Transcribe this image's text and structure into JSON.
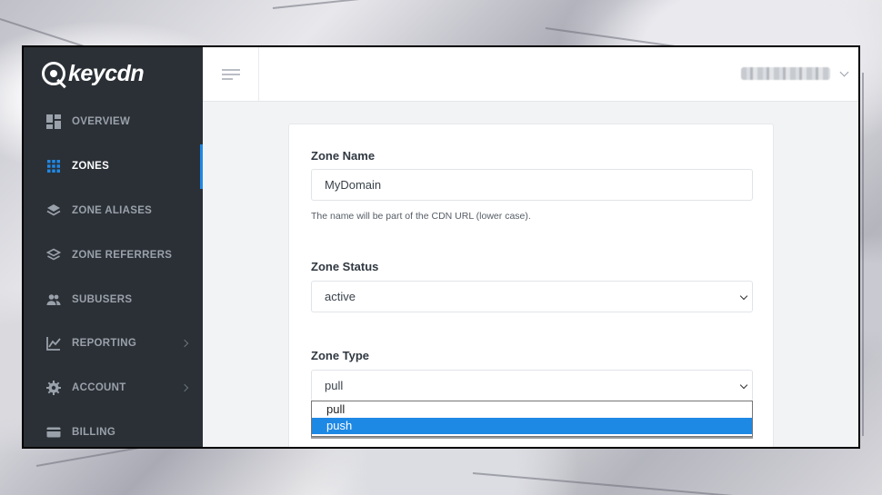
{
  "brand": {
    "name": "keycdn"
  },
  "sidebar": {
    "items": [
      {
        "label": "OVERVIEW",
        "icon": "dashboard-icon",
        "active": false,
        "submenu": false
      },
      {
        "label": "ZONES",
        "icon": "grid-icon",
        "active": true,
        "submenu": false
      },
      {
        "label": "ZONE ALIASES",
        "icon": "layers-icon",
        "active": false,
        "submenu": false
      },
      {
        "label": "ZONE REFERRERS",
        "icon": "layers-outline-icon",
        "active": false,
        "submenu": false
      },
      {
        "label": "SUBUSERS",
        "icon": "users-icon",
        "active": false,
        "submenu": false
      },
      {
        "label": "REPORTING",
        "icon": "chart-icon",
        "active": false,
        "submenu": true
      },
      {
        "label": "ACCOUNT",
        "icon": "gear-icon",
        "active": false,
        "submenu": true
      },
      {
        "label": "BILLING",
        "icon": "credit-card-icon",
        "active": false,
        "submenu": false
      }
    ]
  },
  "topbar": {
    "menu_icon": "hamburger-icon",
    "user_menu_icon": "chevron-down-icon"
  },
  "form": {
    "zone_name": {
      "label": "Zone Name",
      "value": "MyDomain",
      "help": "The name will be part of the CDN URL (lower case)."
    },
    "zone_status": {
      "label": "Zone Status",
      "value": "active"
    },
    "zone_type": {
      "label": "Zone Type",
      "value": "pull",
      "options": [
        {
          "label": "pull",
          "highlighted": false
        },
        {
          "label": "push",
          "highlighted": true
        }
      ]
    }
  },
  "colors": {
    "sidebar_bg": "#2b3036",
    "accent": "#1f88e5",
    "highlight": "#1e88e5"
  }
}
